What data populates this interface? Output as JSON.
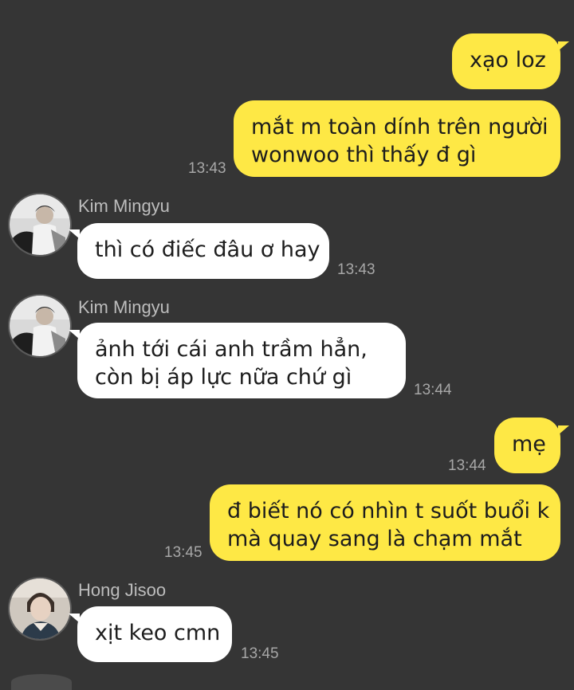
{
  "messages": [
    {
      "id": "m1",
      "side": "me",
      "lines": [
        "xạo loz"
      ],
      "time": ""
    },
    {
      "id": "m2",
      "side": "me",
      "lines": [
        "mắt m toàn dính trên người",
        "wonwoo thì thấy đ gì"
      ],
      "time": "13:43"
    },
    {
      "id": "m3",
      "side": "them",
      "sender": "Kim Mingyu",
      "lines": [
        "thì có điếc đâu ơ hay"
      ],
      "time": "13:43"
    },
    {
      "id": "m4",
      "side": "them",
      "sender": "Kim Mingyu",
      "lines": [
        "ảnh tới cái anh trầm hẳn,",
        "còn bị áp lực nữa chứ gì"
      ],
      "time": "13:44"
    },
    {
      "id": "m5",
      "side": "me",
      "lines": [
        "mẹ"
      ],
      "time": "13:44"
    },
    {
      "id": "m6",
      "side": "me",
      "lines": [
        "đ biết nó có nhìn t suốt buổi k",
        "mà quay sang là chạm mắt"
      ],
      "time": "13:45"
    },
    {
      "id": "m7",
      "side": "them",
      "sender": "Hong Jisoo",
      "lines": [
        "xịt keo cmn"
      ],
      "time": "13:45"
    }
  ],
  "colors": {
    "background": "#353535",
    "my_bubble": "#fee845",
    "their_bubble": "#ffffff",
    "timestamp": "#a7a7a7",
    "sender_name": "#bdbdbd"
  },
  "icons": {
    "avatar_mingyu": "profile-photo",
    "avatar_jisoo": "profile-photo"
  }
}
